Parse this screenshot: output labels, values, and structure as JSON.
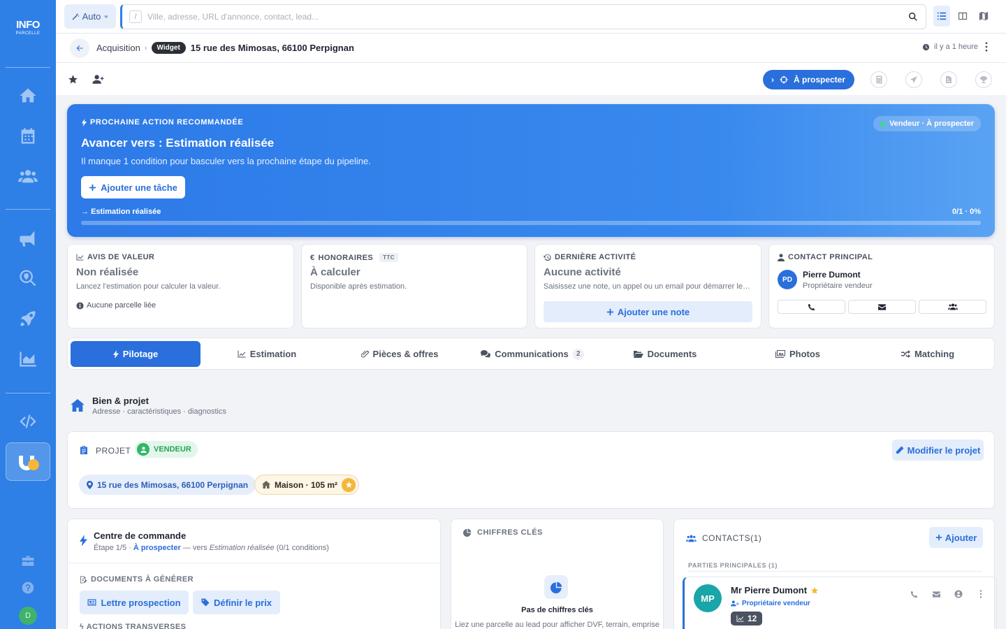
{
  "sidebar": {
    "logo_line1": "INFO",
    "logo_line2": "PARCELLE",
    "items": [
      {
        "name": "home-icon"
      },
      {
        "name": "calendar-icon"
      },
      {
        "name": "users-icon"
      },
      {
        "name": "megaphone-icon"
      },
      {
        "name": "search-location-icon"
      },
      {
        "name": "rocket-icon"
      },
      {
        "name": "chart-area-icon"
      },
      {
        "name": "code-icon"
      },
      {
        "name": "magnet-icon"
      }
    ],
    "avatar_initial": "D"
  },
  "topbar": {
    "auto_label": "Auto",
    "search_shortcut": "/",
    "search_placeholder": "Ville, adresse, URL d'annonce, contact, lead..."
  },
  "breadcrumb": {
    "section": "Acquisition",
    "badge": "Widget",
    "title": "15 rue des Mimosas, 66100 Perpignan",
    "updated": "il y a 1 heure"
  },
  "actions": {
    "status_button": "À prospecter"
  },
  "hero": {
    "kicker": "PROCHAINE ACTION RECOMMANDÉE",
    "title": "Avancer vers : Estimation réalisée",
    "subtitle": "Il manque 1 condition pour basculer vers la prochaine étape du pipeline.",
    "button": "Ajouter une tâche",
    "step": "Estimation réalisée",
    "progress_label": "0/1 · 0%",
    "progress": 0,
    "badge": "Vendeur · À prospecter"
  },
  "cards": {
    "avis": {
      "kicker": "AVIS DE VALEUR",
      "title": "Non réalisée",
      "sub": "Lancez l'estimation pour calculer la valeur.",
      "note": "Aucune parcelle liée"
    },
    "honoraires": {
      "kicker": "HONORAIRES",
      "badge": "TTC",
      "title": "À calculer",
      "sub": "Disponible après estimation."
    },
    "activite": {
      "kicker": "DERNIÈRE ACTIVITÉ",
      "title": "Aucune activité",
      "sub": "Saisissez une note, un appel ou un email pour démarrer le suivi.",
      "button": "Ajouter une note"
    },
    "contact": {
      "kicker": "CONTACT PRINCIPAL",
      "initials": "PD",
      "name": "Pierre Dumont",
      "role": "Propriétaire vendeur"
    }
  },
  "tabs": [
    {
      "label": "Pilotage"
    },
    {
      "label": "Estimation"
    },
    {
      "label": "Pièces & offres"
    },
    {
      "label": "Communications",
      "count": "2"
    },
    {
      "label": "Documents"
    },
    {
      "label": "Photos"
    },
    {
      "label": "Matching"
    }
  ],
  "section": {
    "title": "Bien & projet",
    "subtitle": "Adresse · caractéristiques · diagnostics"
  },
  "project": {
    "kicker": "PROJET",
    "badge": "VENDEUR",
    "edit_button": "Modifier le projet",
    "address": "15 rue des Mimosas, 66100 Perpignan",
    "property": "Maison · 105 m²"
  },
  "command": {
    "title": "Centre de commande",
    "step_prefix": "Étape 1/5 ·",
    "step_link": "À prospecter",
    "step_mid": "— vers",
    "step_target": "Estimation réalisée",
    "step_suffix": "(0/1 conditions)",
    "docs_kicker": "DOCUMENTS À GÉNÉRER",
    "doc1": "Lettre prospection",
    "doc2": "Définir le prix",
    "trans_kicker": "ACTIONS TRANSVERSES"
  },
  "keyfigures": {
    "kicker": "CHIFFRES CLÉS",
    "title": "Pas de chiffres clés",
    "sub": "Liez une parcelle au lead pour afficher DVF, terrain, emprise"
  },
  "contacts": {
    "kicker": "CONTACTS(1)",
    "add_button": "Ajouter",
    "group": "PARTIES PRINCIPALES (1)",
    "person": {
      "initials": "MP",
      "name": "Mr Pierre Dumont",
      "role": "Propriétaire vendeur",
      "count": "12"
    }
  },
  "colors": {
    "primary": "#2a6fdb",
    "sidebar": "#2e7fe6",
    "success": "#2eb867",
    "star": "#f5b63a"
  }
}
